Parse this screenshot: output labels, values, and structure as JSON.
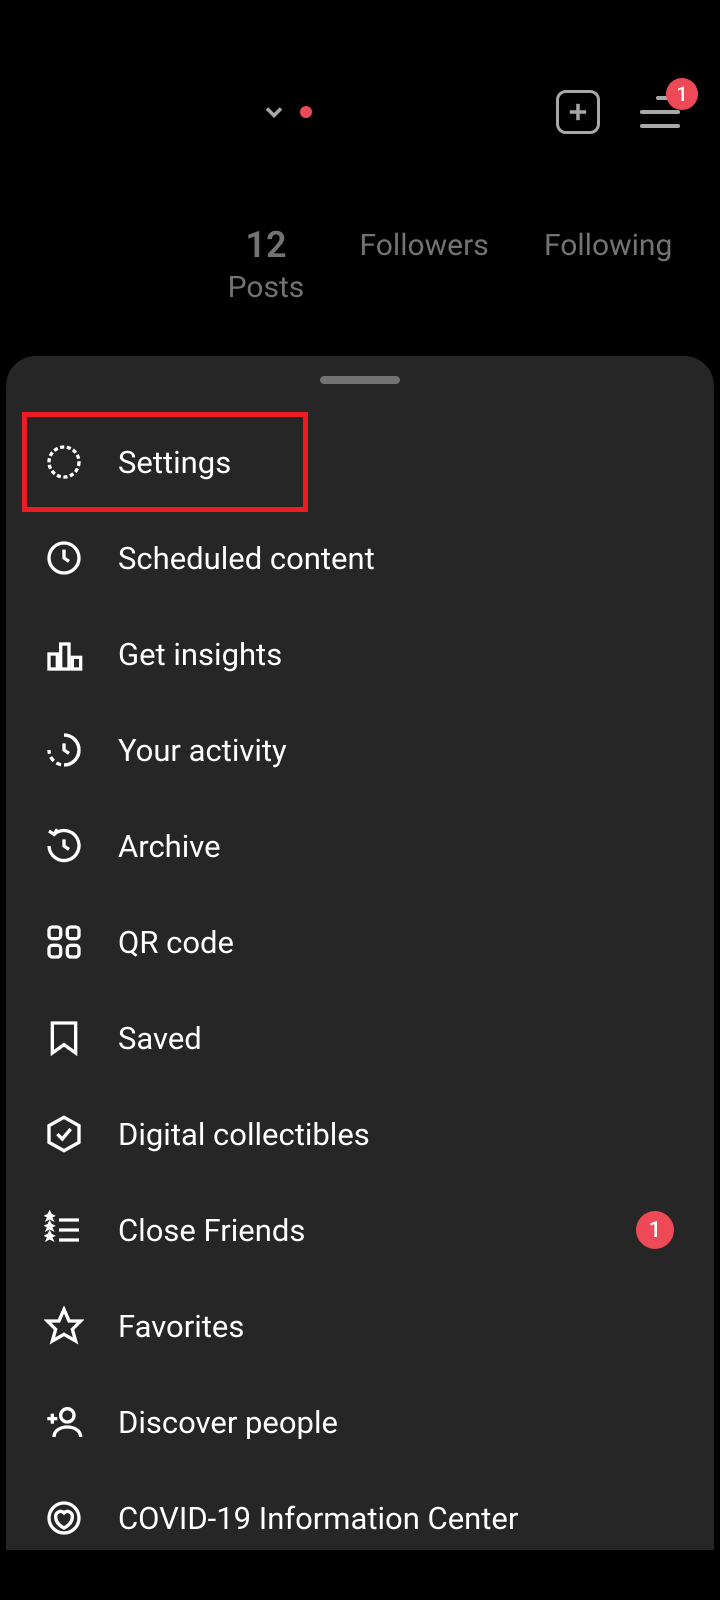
{
  "header": {
    "hamburger_badge": "1"
  },
  "stats": {
    "posts_value": "12",
    "posts_label": "Posts",
    "followers_label": "Followers",
    "following_label": "Following"
  },
  "menu": {
    "items": [
      {
        "label": "Settings",
        "highlighted": true
      },
      {
        "label": "Scheduled content"
      },
      {
        "label": "Get insights"
      },
      {
        "label": "Your activity"
      },
      {
        "label": "Archive"
      },
      {
        "label": "QR code"
      },
      {
        "label": "Saved"
      },
      {
        "label": "Digital collectibles"
      },
      {
        "label": "Close Friends",
        "badge": "1"
      },
      {
        "label": "Favorites"
      },
      {
        "label": "Discover people"
      },
      {
        "label": "COVID-19 Information Center"
      }
    ]
  }
}
